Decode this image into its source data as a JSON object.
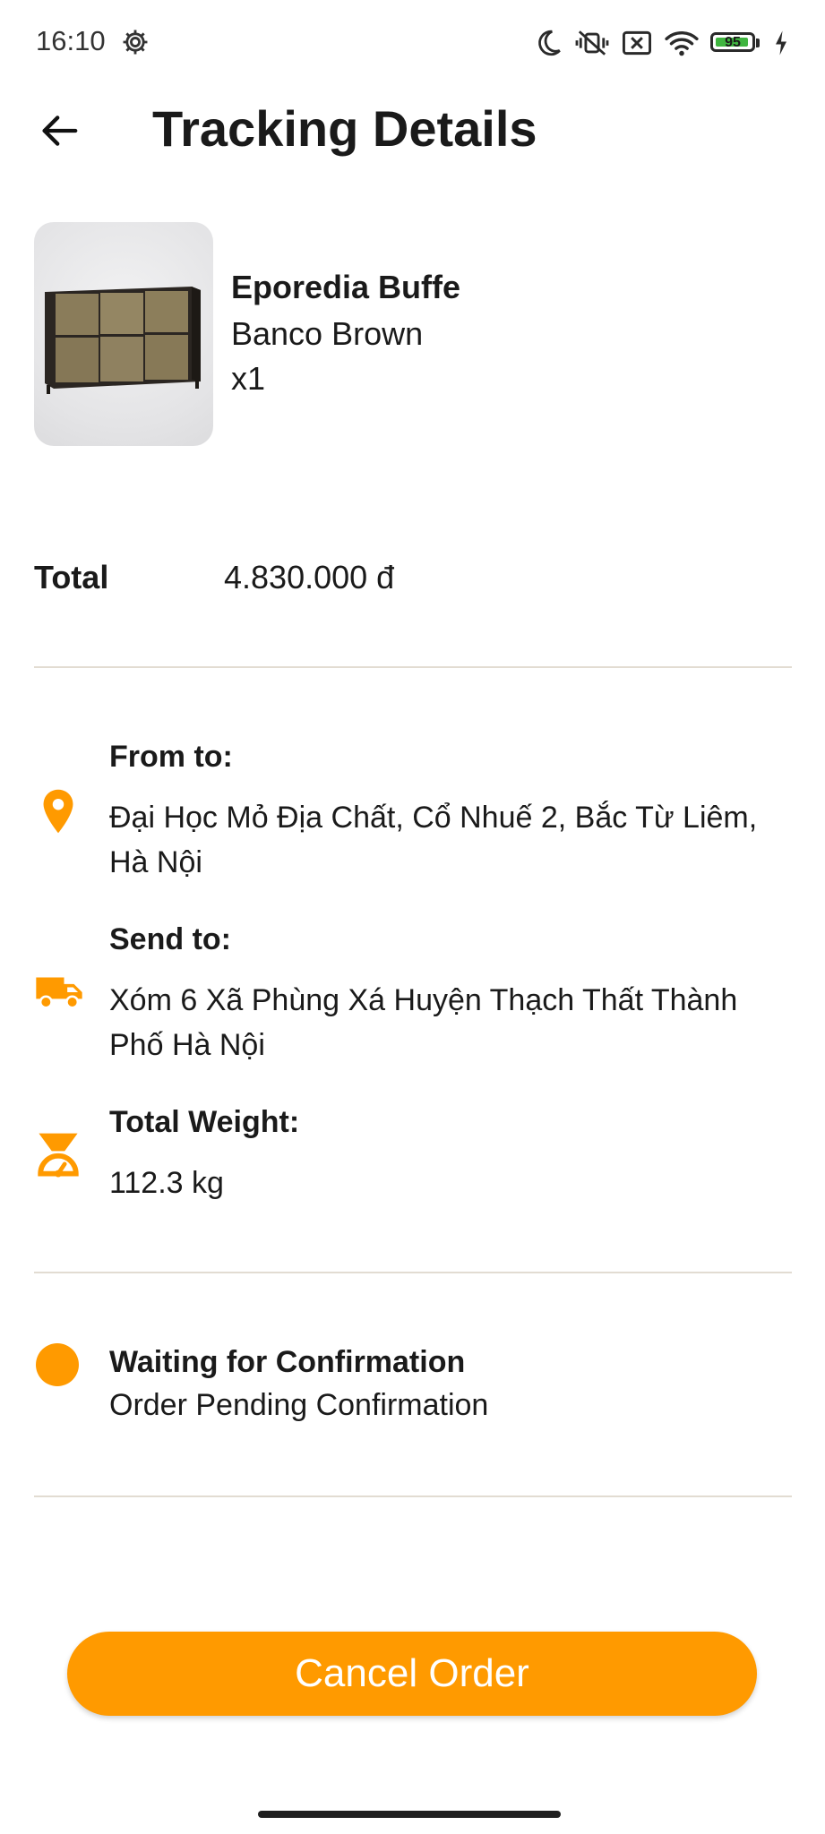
{
  "status_bar": {
    "time": "16:10",
    "battery_level": "95"
  },
  "app_bar": {
    "title": "Tracking Details"
  },
  "product": {
    "name": "Eporedia Buffe",
    "variant": "Banco Brown",
    "quantity": "x1"
  },
  "order": {
    "total_label": "Total",
    "total_value": "4.830.000 đ"
  },
  "shipping": {
    "from_label": "From to:",
    "from_address": "Đại Học Mỏ Địa Chất, Cổ Nhuế 2, Bắc Từ Liêm, Hà Nội",
    "send_label": "Send to:",
    "send_address": "Xóm 6 Xã Phùng Xá Huyện Thạch Thất Thành Phố Hà Nội",
    "weight_label": "Total Weight:",
    "weight_value": "112.3 kg"
  },
  "status": {
    "title": "Waiting for Confirmation",
    "subtitle": "Order Pending Confirmation"
  },
  "actions": {
    "cancel_label": "Cancel Order"
  },
  "colors": {
    "accent": "#ff9a00",
    "divider": "#e2dcd2"
  },
  "icons": {
    "back": "arrow-left-icon",
    "from": "location-pin-icon",
    "send": "truck-icon",
    "weight": "scale-icon",
    "status": "status-dot"
  }
}
